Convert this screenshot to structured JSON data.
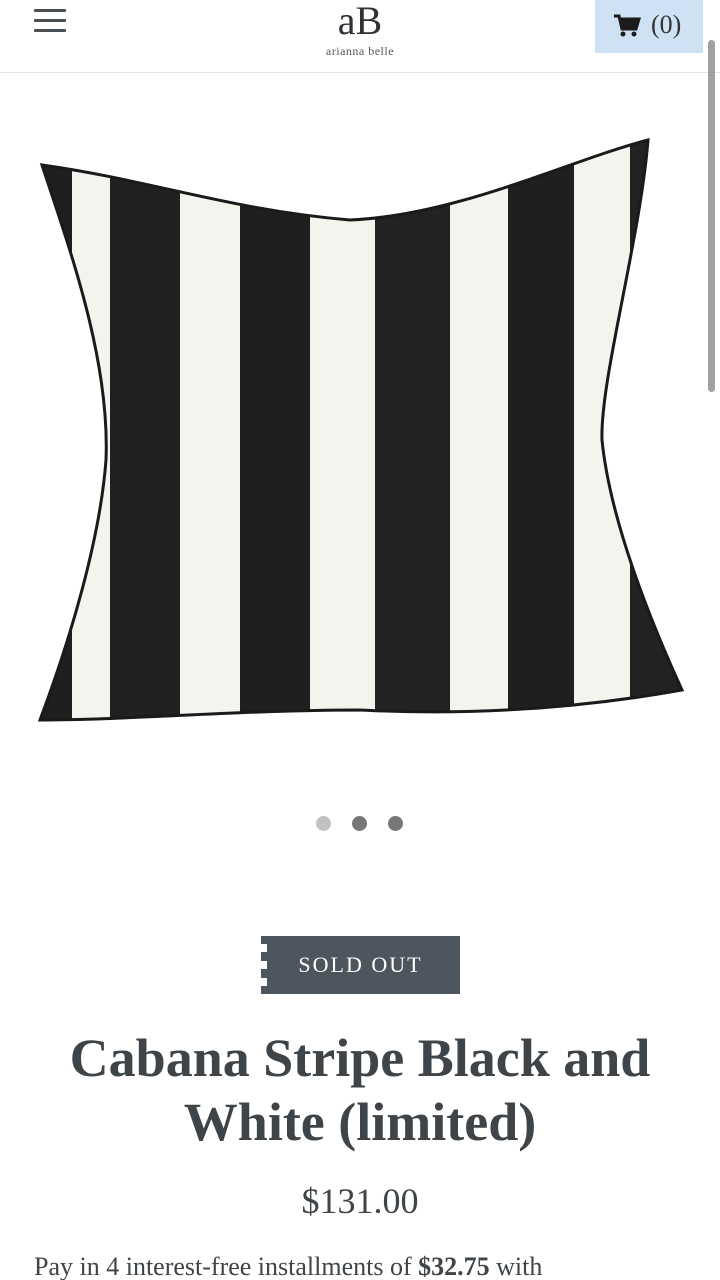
{
  "header": {
    "logo_monogram": "aB",
    "logo_text": "arianna belle",
    "cart_count": "(0)"
  },
  "carousel": {
    "total": 3,
    "active": 1
  },
  "product": {
    "badge": "SOLD OUT",
    "title": "Cabana Stripe Black and White (limited)",
    "price": "$131.00",
    "installments_prefix": "Pay in 4 interest-free installments of ",
    "installment_amount": "$32.75",
    "installments_suffix": " with"
  },
  "colors": {
    "badge_bg": "#4d565e",
    "cart_bg": "#cfe2f3",
    "text": "#3e4448"
  }
}
